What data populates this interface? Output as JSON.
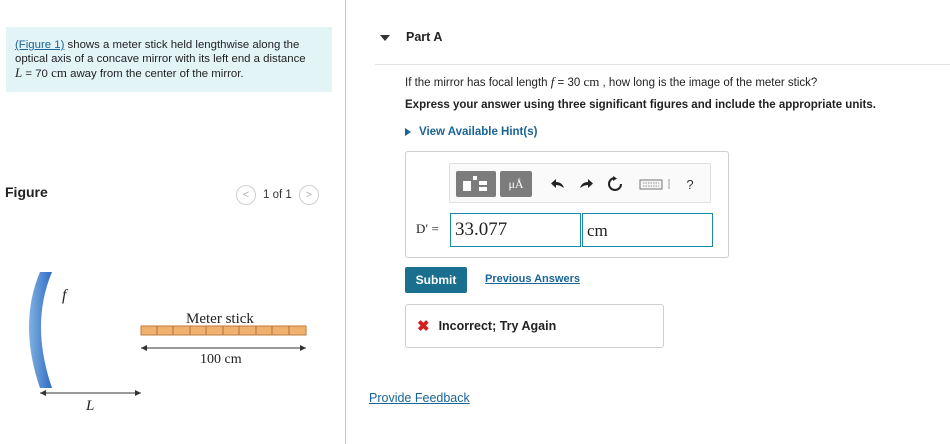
{
  "problem": {
    "figure_link": "(Figure 1)",
    "line1_rest": "shows a meter stick held lengthwise along the",
    "line2": "optical axis of a concave mirror with its left end a distance",
    "line3_var": "L",
    "line3_eq": " = 70 ",
    "line3_unit": "cm",
    "line3_rest": " away from the center of the mirror."
  },
  "figure": {
    "label": "Figure",
    "pager_text": "1 of 1",
    "prev_glyph": "<",
    "next_glyph": ">",
    "f_label": "f",
    "l_label": "L",
    "stick_label": "Meter stick",
    "length_label": "100 cm"
  },
  "part": {
    "title": "Part A",
    "question_pre": "If the mirror has focal length ",
    "question_var": "f",
    "question_eq": " = 30 ",
    "question_unit": "cm",
    "question_post": " , how long is the image of the meter stick?",
    "instructions": "Express your answer using three significant figures and include the appropriate units.",
    "hints": "View Available Hint(s)"
  },
  "toolbar": {
    "mu_label": "μÅ",
    "help_label": "?"
  },
  "answer": {
    "var_label": "D′ =",
    "value": "33.077",
    "unit": "cm"
  },
  "actions": {
    "submit": "Submit",
    "previous_answers": "Previous Answers"
  },
  "feedback": {
    "icon": "✖",
    "text": "Incorrect; Try Again"
  },
  "footer": {
    "provide_feedback": "Provide Feedback"
  }
}
